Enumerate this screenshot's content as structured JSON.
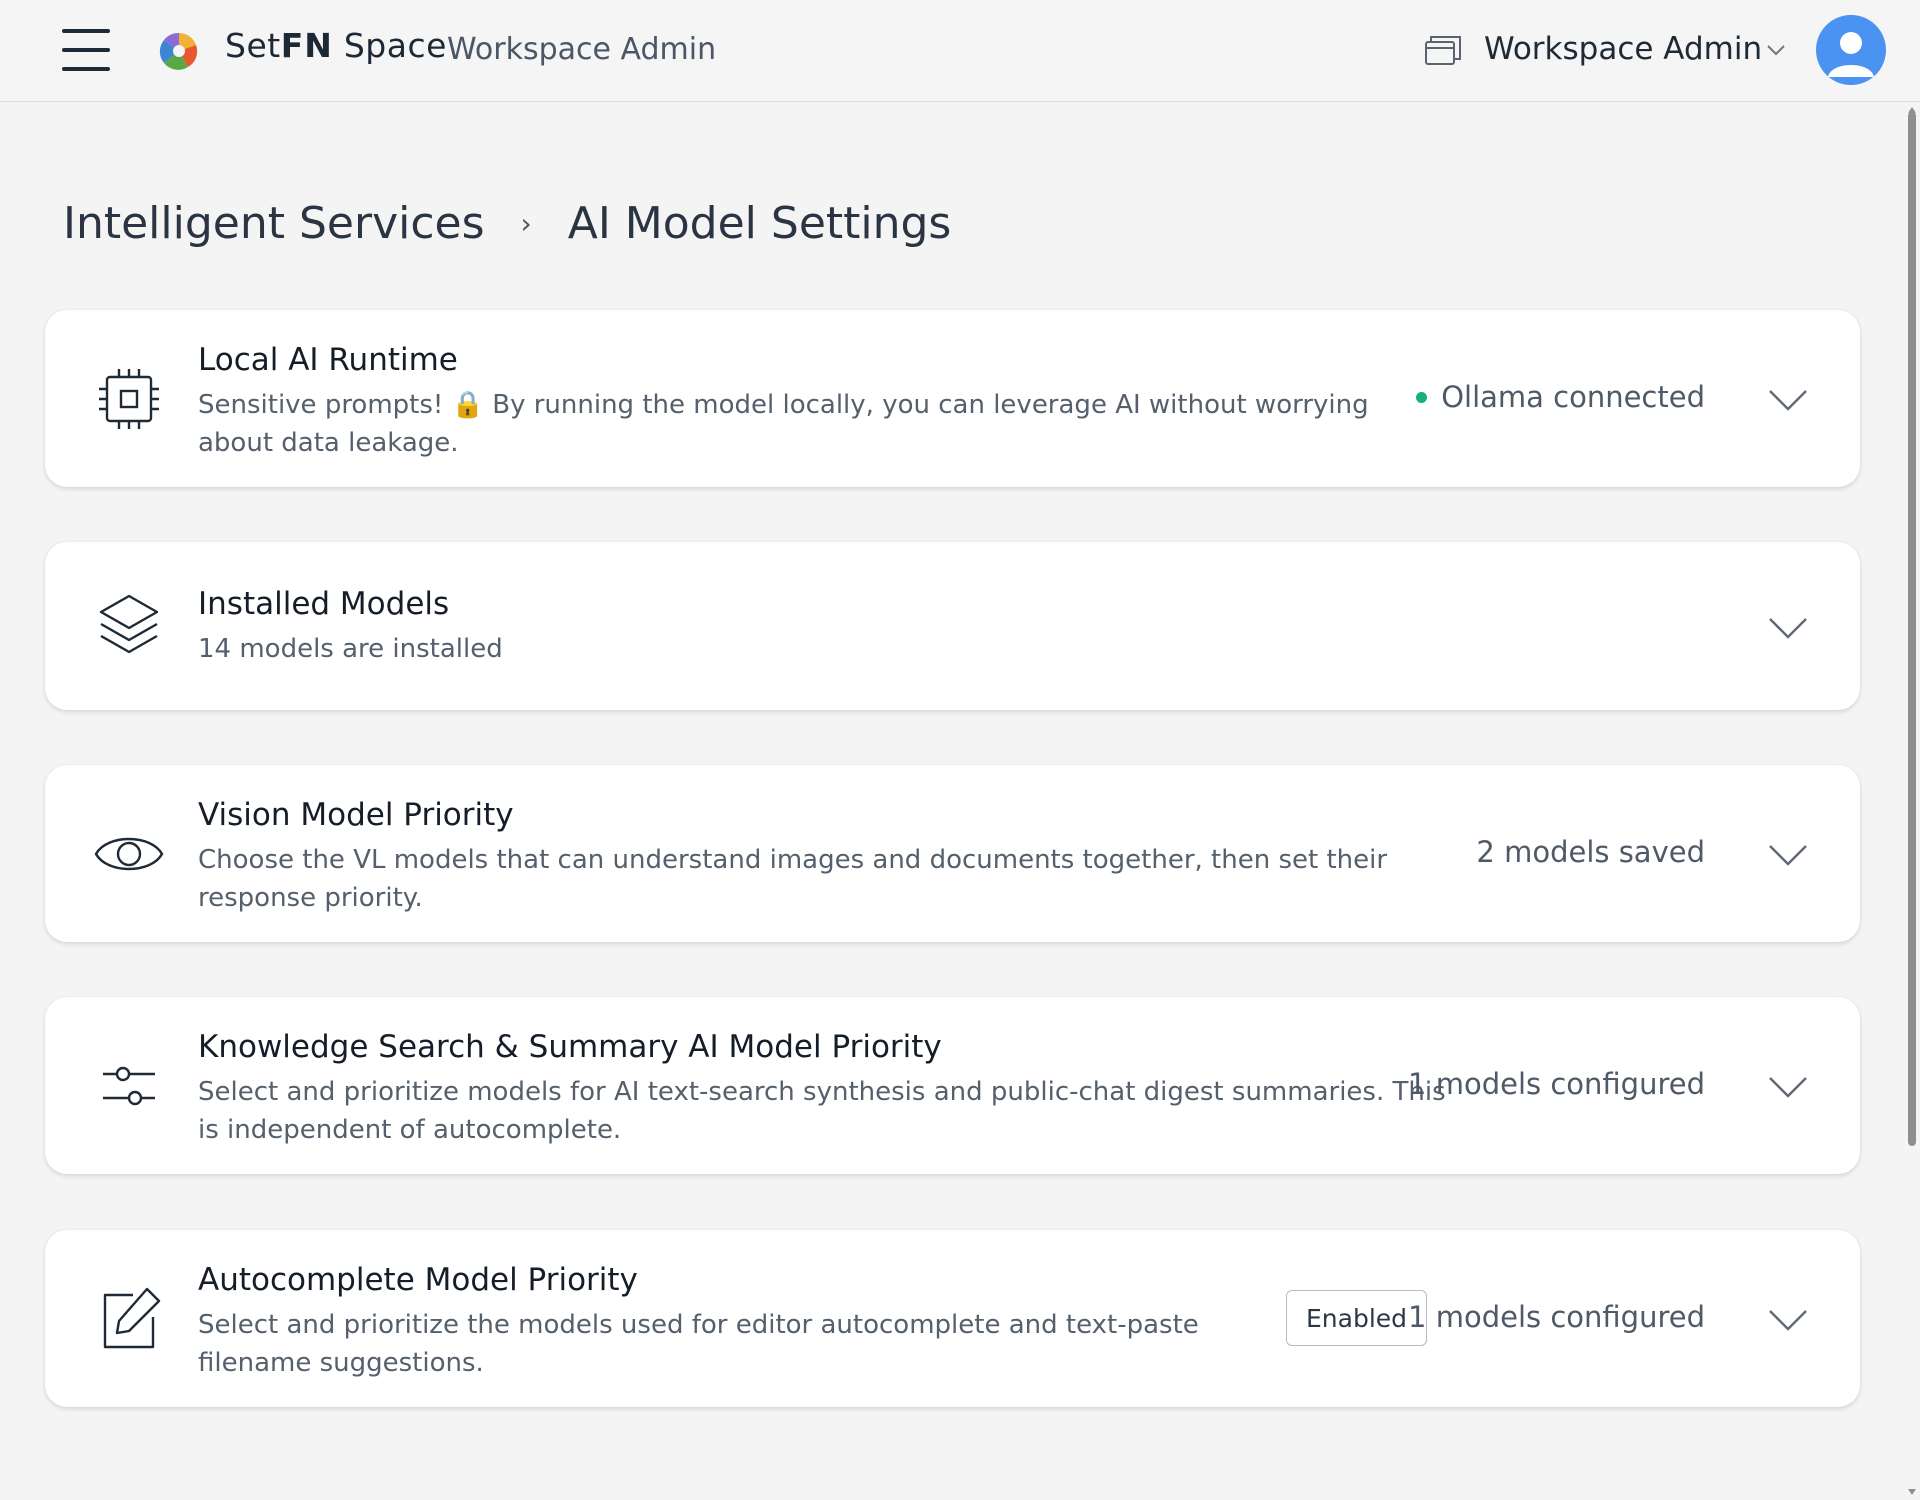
{
  "header": {
    "brand_prefix": "Set",
    "brand_bold": "FN",
    "brand_suffix": " Space",
    "app_subtitle": "Workspace Admin",
    "workspace_name": "Workspace Admin",
    "accent_color": "#4b93f0"
  },
  "breadcrumb": {
    "parent": "Intelligent Services",
    "separator": "›",
    "current": "AI Model Settings"
  },
  "cards": [
    {
      "icon": "cpu-chip-icon",
      "title": "Local AI Runtime",
      "description": "Sensitive prompts! 🔒 By running the model locally, you can leverage AI without worrying about data leakage.",
      "status": "Ollama connected",
      "status_color": "#16b07a"
    },
    {
      "icon": "layers-icon",
      "title": "Installed Models",
      "description": "14 models are installed",
      "status": ""
    },
    {
      "icon": "eye-icon",
      "title": "Vision Model Priority",
      "description": "Choose the VL models that can understand images and documents together, then set their response priority.",
      "status": "2 models saved"
    },
    {
      "icon": "sliders-icon",
      "title": "Knowledge Search & Summary AI Model Priority",
      "description": "Select and prioritize models for AI text-search synthesis and public-chat digest summaries. This is independent of autocomplete.",
      "status": "1 models configured"
    },
    {
      "icon": "edit-icon",
      "title": "Autocomplete Model Priority",
      "description": "Select and prioritize the models used for editor autocomplete and text-paste filename suggestions.",
      "badge": "Enabled",
      "status": "1 models configured"
    }
  ]
}
